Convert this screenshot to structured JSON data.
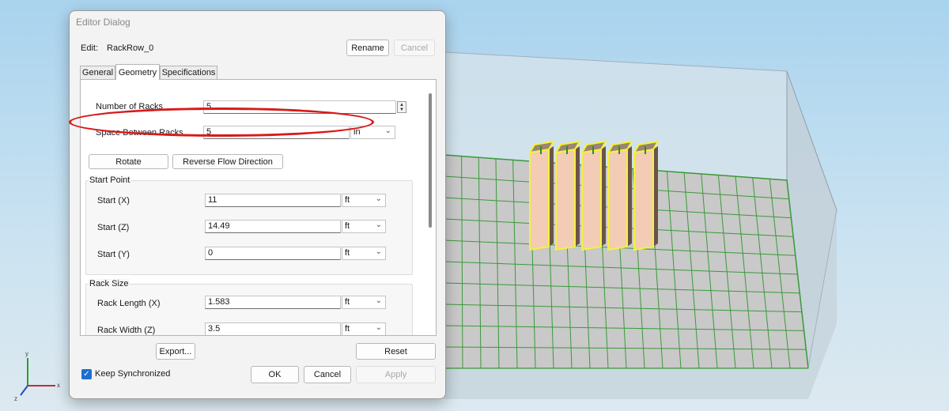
{
  "dialog": {
    "title": "Editor Dialog",
    "edit_label": "Edit:",
    "edit_value": "RackRow_0",
    "rename_label": "Rename",
    "cancel_top_label": "Cancel",
    "tabs": [
      {
        "label": "General",
        "active": false
      },
      {
        "label": "Geometry",
        "active": true
      },
      {
        "label": "Specifications",
        "active": false
      }
    ],
    "geometry": {
      "number_of_racks": {
        "label": "Number of Racks",
        "value": "5"
      },
      "space_between_racks": {
        "label": "Space Between Racks",
        "value": "5",
        "unit": "in"
      },
      "rotate_label": "Rotate",
      "reverse_flow_label": "Reverse Flow Direction",
      "start_point": {
        "title": "Start Point",
        "x": {
          "label": "Start (X)",
          "value": "11",
          "unit": "ft"
        },
        "z": {
          "label": "Start (Z)",
          "value": "14.49",
          "unit": "ft"
        },
        "y": {
          "label": "Start (Y)",
          "value": "0",
          "unit": "ft"
        }
      },
      "rack_size": {
        "title": "Rack Size",
        "length": {
          "label": "Rack Length (X)",
          "value": "1.583",
          "unit": "ft"
        },
        "width": {
          "label": "Rack Width (Z)",
          "value": "3.5",
          "unit": "ft"
        }
      }
    },
    "footer": {
      "export_label": "Export...",
      "reset_label": "Reset",
      "keep_synchronized_label": "Keep Synchronized",
      "keep_synchronized_checked": true,
      "ok_label": "OK",
      "cancel_label": "Cancel",
      "apply_label": "Apply"
    }
  },
  "scene": {
    "rack_count": 5,
    "rack_fill": "#f3ccb5",
    "selection_color": "#f4f23c",
    "grid_color": "#3a9a3a"
  },
  "axes": {
    "x": "x",
    "y": "y",
    "z": "z"
  },
  "colors": {
    "highlight": "#d71a1a",
    "accent": "#1f6fd1"
  }
}
